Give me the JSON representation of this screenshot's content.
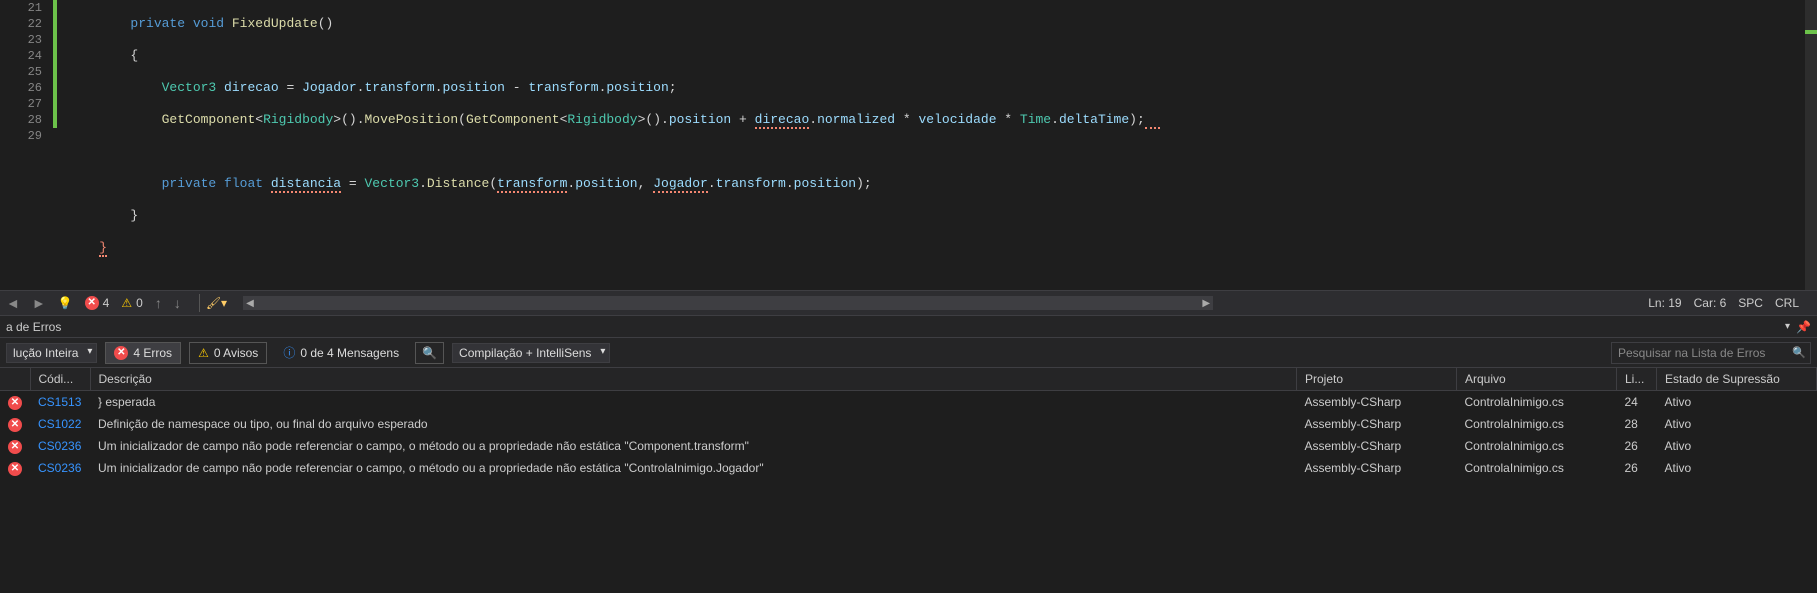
{
  "editor": {
    "lines_start": 21,
    "lines_end": 29,
    "tokens": {
      "l21_private": "private",
      "l21_void": "void",
      "l21_method": "FixedUpdate",
      "l21_parens": "()",
      "l22_brace": "{",
      "l23_vector3": "Vector3",
      "l23_direcao": "direcao",
      "l23_eq": " = ",
      "l23_jogador": "Jogador",
      "l23_dot1": ".",
      "l23_transform1": "transform",
      "l23_dot2": ".",
      "l23_position1": "position",
      "l23_minus": " - ",
      "l23_transform2": "transform",
      "l23_dot3": ".",
      "l23_position2": "position",
      "l23_semi": ";",
      "l24_getcomp1": "GetComponent",
      "l24_lt1": "<",
      "l24_rigid1": "Rigidbody",
      "l24_gt1": ">",
      "l24_parens1": "().",
      "l24_movepos": "MovePosition",
      "l24_lparen": "(",
      "l24_getcomp2": "GetComponent",
      "l24_lt2": "<",
      "l24_rigid2": "Rigidbody",
      "l24_gt2": ">",
      "l24_parens2": "().",
      "l24_position": "position",
      "l24_plus": " + ",
      "l24_direcao": "direcao",
      "l24_dot1": ".",
      "l24_normalized": "normalized",
      "l24_star1": " * ",
      "l24_velocidade": "velocidade",
      "l24_star2": " * ",
      "l24_time": "Time",
      "l24_dot2": ".",
      "l24_deltatime": "deltaTime",
      "l24_end": ");",
      "l26_private": "private",
      "l26_float": "float",
      "l26_distancia": "distancia",
      "l26_eq": " = ",
      "l26_vector3": "Vector3",
      "l26_dot1": ".",
      "l26_distance": "Distance",
      "l26_lparen": "(",
      "l26_transform": "transform",
      "l26_dot2": ".",
      "l26_position1": "position",
      "l26_comma": ", ",
      "l26_jogador": "Jogador",
      "l26_dot3": ".",
      "l26_transform2": "transform",
      "l26_dot4": ".",
      "l26_position2": "position",
      "l26_end": ");",
      "l27_brace": "}",
      "l28_brace": "}"
    }
  },
  "status": {
    "errors": "4",
    "warnings": "0",
    "ln_label": "Ln: 19",
    "car_label": "Car: 6",
    "spc": "SPC",
    "crlf": "CRL"
  },
  "panel": {
    "title": "a de Erros"
  },
  "toolbar": {
    "scope": "lução Inteira",
    "errors": "4 Erros",
    "warnings": "0 Avisos",
    "messages": "0 de 4 Mensagens",
    "build": "Compilação + IntelliSens",
    "search_placeholder": "Pesquisar na Lista de Erros"
  },
  "columns": {
    "code": "Códi...",
    "desc": "Descrição",
    "project": "Projeto",
    "file": "Arquivo",
    "line": "Li...",
    "suppression": "Estado de Supressão"
  },
  "errors_list": [
    {
      "code": "CS1513",
      "desc": "} esperada",
      "project": "Assembly-CSharp",
      "file": "ControlaInimigo.cs",
      "line": "24",
      "state": "Ativo"
    },
    {
      "code": "CS1022",
      "desc": "Definição de namespace ou tipo, ou final do arquivo esperado",
      "project": "Assembly-CSharp",
      "file": "ControlaInimigo.cs",
      "line": "28",
      "state": "Ativo"
    },
    {
      "code": "CS0236",
      "desc": "Um inicializador de campo não pode referenciar o campo, o método ou a propriedade não estática \"Component.transform\"",
      "project": "Assembly-CSharp",
      "file": "ControlaInimigo.cs",
      "line": "26",
      "state": "Ativo"
    },
    {
      "code": "CS0236",
      "desc": "Um inicializador de campo não pode referenciar o campo, o método ou a propriedade não estática \"ControlaInimigo.Jogador\"",
      "project": "Assembly-CSharp",
      "file": "ControlaInimigo.cs",
      "line": "26",
      "state": "Ativo"
    }
  ]
}
